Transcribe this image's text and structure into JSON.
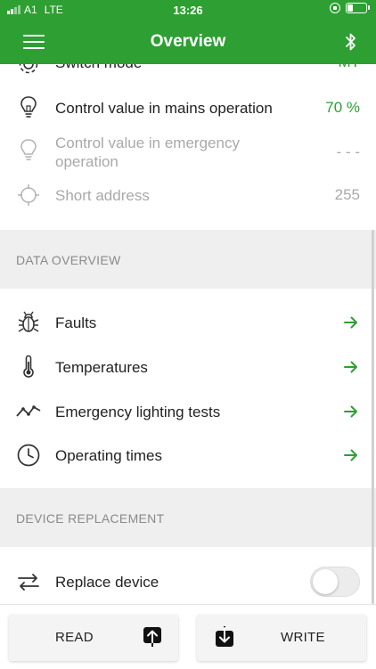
{
  "status_bar": {
    "carrier": "A1",
    "network": "LTE",
    "time": "13:26"
  },
  "nav": {
    "title": "Overview"
  },
  "rows": {
    "switch_mode": {
      "label": "Switch mode",
      "value": "MT"
    },
    "mains_control": {
      "label": "Control value in mains operation",
      "value": "70 %"
    },
    "emergency_control": {
      "label": "Control value in emergency operation",
      "value": "- - -"
    },
    "short_address": {
      "label": "Short address",
      "value": "255"
    }
  },
  "sections": {
    "data_overview": "DATA OVERVIEW",
    "device_replacement": "DEVICE REPLACEMENT"
  },
  "data_overview_items": [
    {
      "label": "Faults",
      "icon": "bug-icon"
    },
    {
      "label": "Temperatures",
      "icon": "thermometer-icon"
    },
    {
      "label": "Emergency lighting tests",
      "icon": "trend-line-icon"
    },
    {
      "label": "Operating times",
      "icon": "clock-icon"
    }
  ],
  "replace_device": {
    "label": "Replace device",
    "enabled": false
  },
  "buttons": {
    "read": "READ",
    "write": "WRITE"
  },
  "colors": {
    "brand": "#2e9f32",
    "section_bg": "#efefef",
    "disabled_text": "#a9a9a9"
  }
}
